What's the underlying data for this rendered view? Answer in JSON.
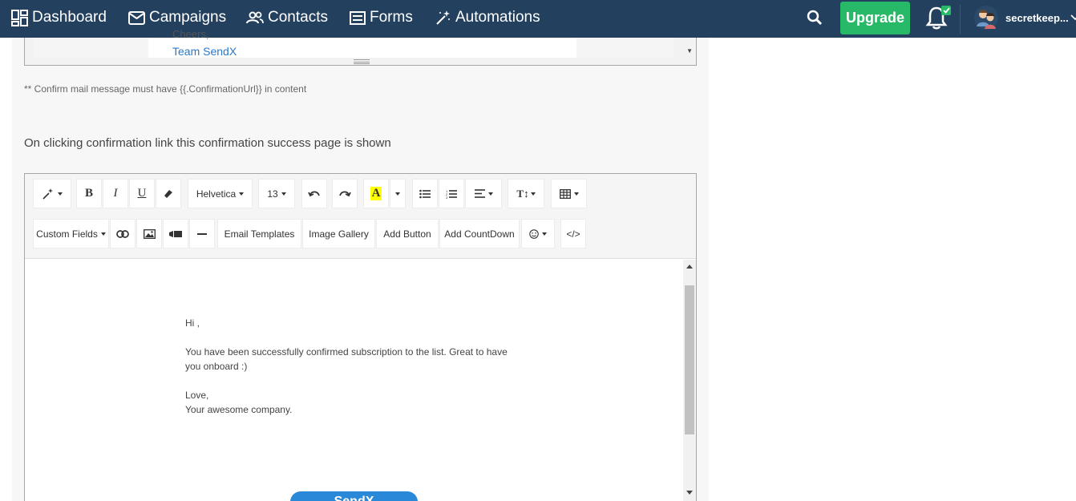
{
  "nav": {
    "items": [
      {
        "label": "Dashboard",
        "icon": "dashboard-icon"
      },
      {
        "label": "Campaigns",
        "icon": "envelope-icon"
      },
      {
        "label": "Contacts",
        "icon": "users-icon"
      },
      {
        "label": "Forms",
        "icon": "form-icon"
      },
      {
        "label": "Automations",
        "icon": "magic-wand-icon"
      }
    ],
    "upgrade_label": "Upgrade",
    "user_name": "secretkeep...",
    "colors": {
      "nav_bg": "#23405e",
      "upgrade_bg": "#27b968",
      "link": "#2a78c8"
    }
  },
  "top_editor": {
    "cheers": "Cheers,",
    "team": "Team SendX"
  },
  "note": "** Confirm mail message must have {{.ConfirmationUrl}} in content",
  "paragraph": "On clicking confirmation link this confirmation success page is shown",
  "toolbar": {
    "font": "Helvetica",
    "size": "13",
    "bold": "B",
    "italic": "I",
    "underline": "U",
    "text_color": "A",
    "text_size": "T↕",
    "custom_fields": "Custom Fields",
    "email_templates": "Email Templates",
    "image_gallery": "Image Gallery",
    "add_button": "Add Button",
    "add_countdown": "Add CountDown",
    "code": "</>"
  },
  "message": {
    "greeting": "Hi ,",
    "line1": "You have been successfully confirmed subscription to the list. Great to have",
    "line2": "you onboard :)",
    "love": "Love,",
    "company": "Your awesome company.",
    "button": "SendX"
  }
}
